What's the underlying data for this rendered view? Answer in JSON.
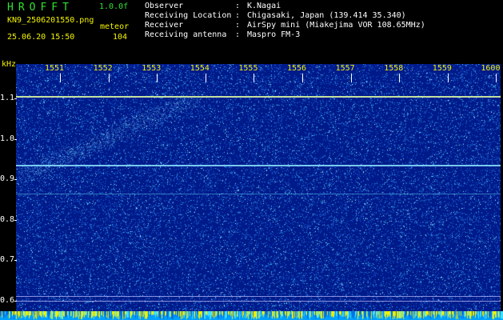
{
  "app": {
    "name": "HROFFT",
    "version": "1.0.0f"
  },
  "file": {
    "name": "KN9_2506201550.png",
    "datetime": "25.06.20 15:50"
  },
  "meteor": {
    "label": "meteor",
    "count": "104"
  },
  "info": [
    {
      "key": "Observer",
      "value": "K.Nagai"
    },
    {
      "key": "Receiving Location",
      "value": "Chigasaki, Japan (139.414 35.340)"
    },
    {
      "key": "Receiver",
      "value": "AirSpy mini (Miakejima VOR 108.65MHz)"
    },
    {
      "key": "Receiving antenna",
      "value": "Maspro FM-3"
    }
  ],
  "spectrogram": {
    "unit": "kHz",
    "freq_ticks": [
      "1.1",
      "1.0",
      "0.9",
      "0.8",
      "0.7",
      "0.6"
    ],
    "time_ticks": [
      "1551",
      "1552",
      "1553",
      "1554",
      "1555",
      "1556",
      "1557",
      "1558",
      "1559",
      "1600"
    ],
    "colors": {
      "background": "#001a8a",
      "signal": "#3bd7ff",
      "carrier": "#c8f0a0",
      "text": "#f4f400"
    }
  }
}
